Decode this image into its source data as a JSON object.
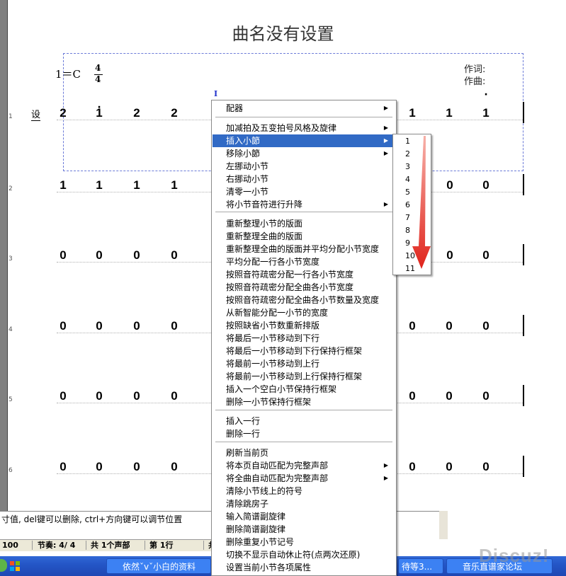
{
  "score": {
    "title": "曲名没有设置",
    "key_signature": "1＝C",
    "time_numerator": "4",
    "time_denominator": "4",
    "lyricist_label": "作词:",
    "composer_label": "作曲:",
    "insert_marker": "I",
    "set_label": "设",
    "row_numbers": [
      "1",
      "2",
      "3",
      "4",
      "5",
      "6"
    ],
    "rows": [
      {
        "left": [
          "2",
          "1",
          "2",
          "2"
        ],
        "right": [
          "1",
          "1",
          "1"
        ],
        "dots_left": [
          false,
          true,
          false,
          false
        ],
        "dots_right": [
          false,
          false,
          true
        ]
      },
      {
        "left": [
          "1",
          "1",
          "1",
          "1"
        ],
        "right": [
          "0",
          "0"
        ]
      },
      {
        "left": [
          "0",
          "0",
          "0",
          "0"
        ],
        "right": [
          "0",
          "0"
        ]
      },
      {
        "left": [
          "0",
          "0",
          "0",
          "0"
        ],
        "right": [
          "0",
          "0",
          "0"
        ]
      },
      {
        "left": [
          "0",
          "0",
          "0",
          "0"
        ],
        "right": [
          "0",
          "0",
          "0"
        ]
      },
      {
        "left": [
          "0",
          "0",
          "0",
          "0"
        ],
        "right": [
          "0",
          "0",
          "0"
        ]
      }
    ]
  },
  "context_menu": {
    "items": [
      {
        "label": "配器",
        "submenu": true
      },
      {
        "label": "加减拍及五变拍号风格及旋律",
        "submenu": true
      },
      {
        "label": "插入小節",
        "submenu": true,
        "selected": true
      },
      {
        "label": "移除小節",
        "submenu": true
      },
      {
        "label": "左挪动小节"
      },
      {
        "label": "右挪动小节"
      },
      {
        "label": "清零一小节"
      },
      {
        "label": "将小节音符进行升降",
        "submenu": true
      },
      {
        "label": "重新整理小节的版面"
      },
      {
        "label": "重新整理全曲的版面"
      },
      {
        "label": "重新整理全曲的版面并平均分配小节宽度"
      },
      {
        "label": "平均分配一行各小节宽度"
      },
      {
        "label": "按照音符疏密分配一行各小节宽度"
      },
      {
        "label": "按照音符疏密分配全曲各小节宽度"
      },
      {
        "label": "按照音符疏密分配全曲各小节数量及宽度"
      },
      {
        "label": "从新智能分配一小节的宽度"
      },
      {
        "label": "按照缺省小节数重新排版"
      },
      {
        "label": "将最后一小节移动到下行"
      },
      {
        "label": "将最后一小节移动到下行保持行框架"
      },
      {
        "label": "将最前一小节移动到上行"
      },
      {
        "label": "将最前一小节移动到上行保持行框架"
      },
      {
        "label": "插入一个空白小节保持行框架"
      },
      {
        "label": "删除一小节保持行框架"
      },
      {
        "label": "插入一行"
      },
      {
        "label": "删除一行"
      },
      {
        "label": "刷新当前页"
      },
      {
        "label": "将本页自动匹配为完整声部",
        "submenu": true
      },
      {
        "label": "将全曲自动匹配为完整声部",
        "submenu": true
      },
      {
        "label": "清除小节线上的符号"
      },
      {
        "label": "清除跳房子"
      },
      {
        "label": "输入简谱副旋律"
      },
      {
        "label": "删除简谱副旋律"
      },
      {
        "label": "删除重复小节记号"
      },
      {
        "label": "切换不显示自动休止符(点两次还原)"
      },
      {
        "label": "设置当前小节各项属性"
      }
    ],
    "submenu_items": [
      "1",
      "2",
      "3",
      "4",
      "5",
      "6",
      "7",
      "8",
      "9",
      "10",
      "11"
    ]
  },
  "status": {
    "hint": "寸值, del键可以删除, ctrl+方向键可以调节位置",
    "zoom": "100",
    "meter": "节奏: 4/ 4",
    "parts": "共 1个声部",
    "line": "第 1行",
    "extra": "共"
  },
  "taskbar": {
    "item1": "依然ˇvˇ小白的资料",
    "item2": "待等3...",
    "item3": "音乐直谱家论坛"
  },
  "watermark": "Discuz!",
  "colors": {
    "selection": "#316ac5",
    "taskbar": "#2456c7",
    "arrow": "#e8342a",
    "dashed_box": "#6c7bd8"
  }
}
